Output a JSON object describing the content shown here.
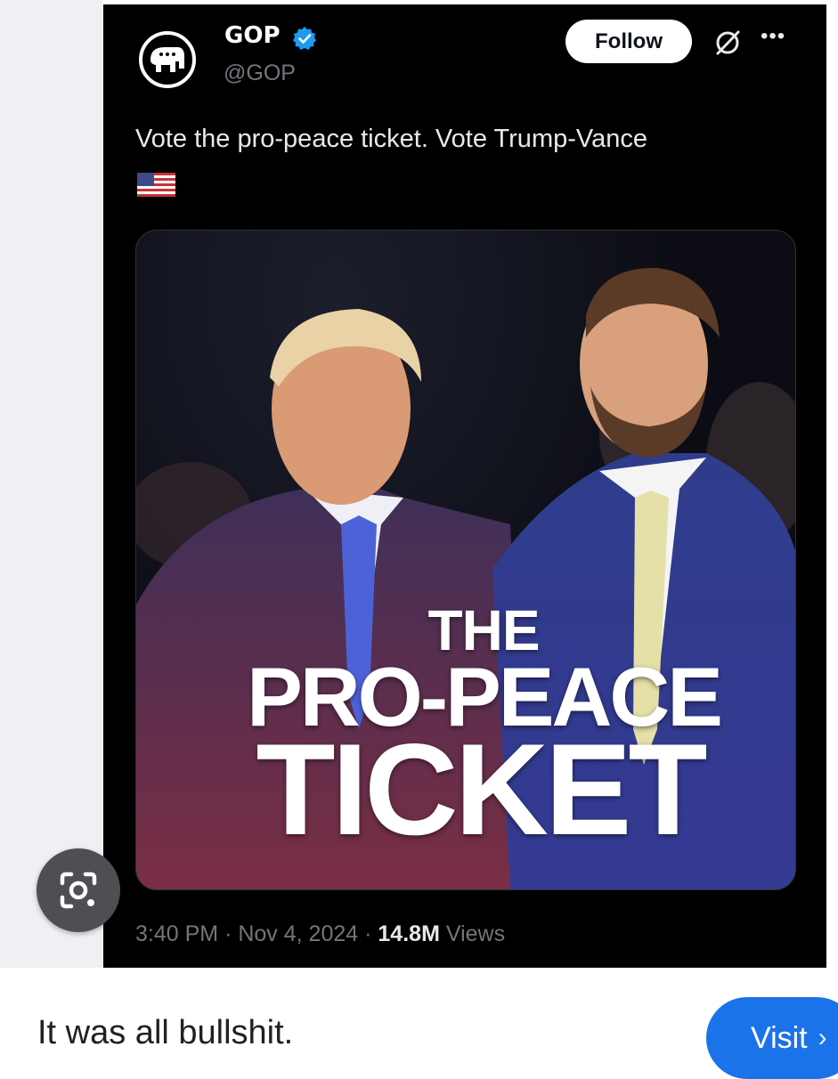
{
  "tweet": {
    "display_name": "GOP",
    "handle": "@GOP",
    "follow_label": "Follow",
    "more_label": "•••",
    "text": "Vote the pro-peace ticket. Vote Trump-Vance",
    "flag_icon": "us-flag-icon",
    "image_headline": {
      "line1": "THE",
      "line2": "PRO-PEACE",
      "line3": "TICKET"
    },
    "time": "3:40 PM",
    "date": "Nov 4, 2024",
    "views_count": "14.8M",
    "views_label": "Views",
    "separator": "·"
  },
  "caption": "It was all bullshit.",
  "visit_label": "Visit",
  "visit_icon": "chevron-right-icon",
  "lens_icon": "google-lens-icon",
  "colors": {
    "verified": "#1d9bf0",
    "visit_button": "#1a73e8",
    "tweet_bg": "#000000"
  }
}
